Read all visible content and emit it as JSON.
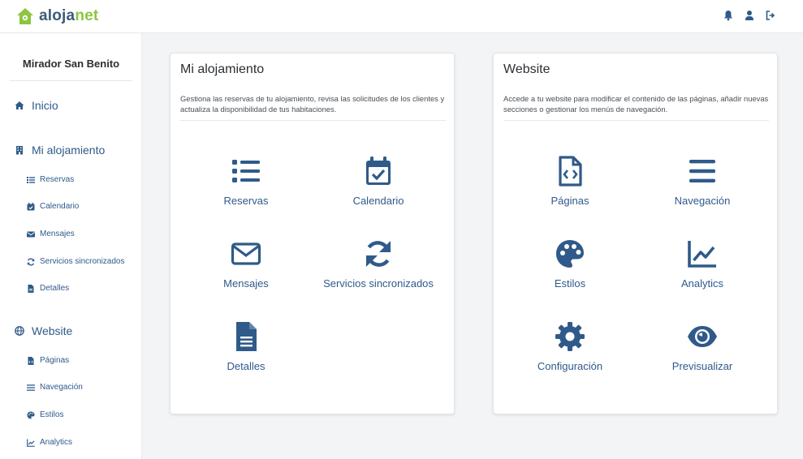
{
  "brand": {
    "name_part1": "aloja",
    "name_part2": "net",
    "color_primary": "#3d5a7a",
    "color_accent": "#8cc63f"
  },
  "topbar": {
    "icons": [
      "bell-icon",
      "user-icon",
      "logout-icon"
    ]
  },
  "sidebar": {
    "property_name": "Mirador San Benito",
    "items": [
      {
        "label": "Inicio",
        "icon": "home-icon"
      },
      {
        "label": "Mi alojamiento",
        "icon": "building-icon"
      },
      {
        "label": "Reservas",
        "icon": "list-icon"
      },
      {
        "label": "Calendario",
        "icon": "calendar-icon"
      },
      {
        "label": "Mensajes",
        "icon": "envelope-icon"
      },
      {
        "label": "Servicios sincronizados",
        "icon": "sync-icon"
      },
      {
        "label": "Detalles",
        "icon": "file-icon"
      },
      {
        "label": "Website",
        "icon": "globe-icon"
      },
      {
        "label": "Páginas",
        "icon": "file-code-icon"
      },
      {
        "label": "Navegación",
        "icon": "bars-icon"
      },
      {
        "label": "Estilos",
        "icon": "palette-icon"
      },
      {
        "label": "Analytics",
        "icon": "chart-line-icon"
      }
    ]
  },
  "cards": {
    "alojamiento": {
      "title": "Mi alojamiento",
      "description": "Gestiona las reservas de tu alojamiento, revisa las solicitudes de los clientes y actualiza la disponibilidad de tus habitaciones.",
      "tiles": [
        {
          "label": "Reservas",
          "icon": "list-icon"
        },
        {
          "label": "Calendario",
          "icon": "calendar-check-icon"
        },
        {
          "label": "Mensajes",
          "icon": "envelope-icon"
        },
        {
          "label": "Servicios sincronizados",
          "icon": "sync-icon"
        },
        {
          "label": "Detalles",
          "icon": "file-alt-icon"
        }
      ]
    },
    "website": {
      "title": "Website",
      "description": "Accede a tu website para modificar el contenido de las páginas, añadir nuevas secciones o gestionar los menús de navegación.",
      "tiles": [
        {
          "label": "Páginas",
          "icon": "file-code-icon"
        },
        {
          "label": "Navegación",
          "icon": "bars-icon"
        },
        {
          "label": "Estilos",
          "icon": "palette-icon"
        },
        {
          "label": "Analytics",
          "icon": "chart-line-icon"
        },
        {
          "label": "Configuración",
          "icon": "cog-icon"
        },
        {
          "label": "Previsualizar",
          "icon": "eye-icon"
        }
      ]
    }
  },
  "colors": {
    "link": "#2f5a8a",
    "background": "#f3f4f6"
  }
}
